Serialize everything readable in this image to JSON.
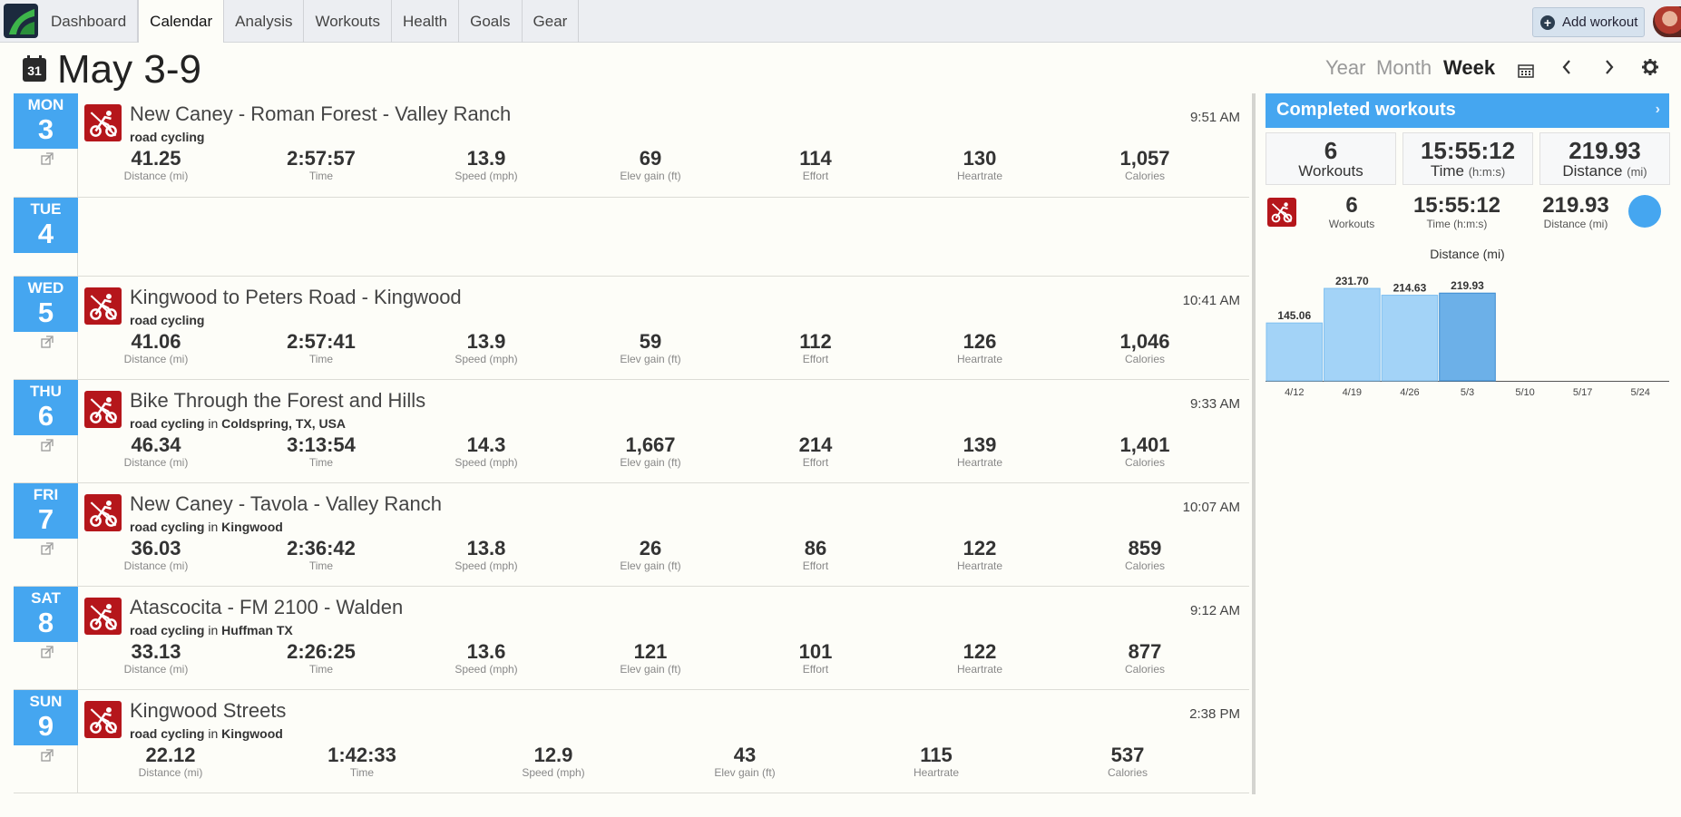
{
  "nav": {
    "tabs": [
      {
        "label": "Dashboard"
      },
      {
        "label": "Calendar"
      },
      {
        "label": "Analysis"
      },
      {
        "label": "Workouts"
      },
      {
        "label": "Health"
      },
      {
        "label": "Goals"
      },
      {
        "label": "Gear"
      }
    ],
    "active_tab": "Calendar",
    "add_workout": "Add workout"
  },
  "header": {
    "calendar_icon_day": "31",
    "title": "May 3-9",
    "views": {
      "year": "Year",
      "month": "Month",
      "week": "Week"
    },
    "active_view": "Week"
  },
  "days": [
    {
      "day": "MON",
      "date": "3",
      "workout": {
        "title": "New Caney - Roman Forest - Valley Ranch",
        "sport": "road cycling",
        "location": "",
        "time": "9:51 AM",
        "stats": [
          {
            "value": "41.25",
            "label": "Distance (mi)"
          },
          {
            "value": "2:57:57",
            "label": "Time"
          },
          {
            "value": "13.9",
            "label": "Speed (mph)"
          },
          {
            "value": "69",
            "label": "Elev gain (ft)"
          },
          {
            "value": "114",
            "label": "Effort"
          },
          {
            "value": "130",
            "label": "Heartrate"
          },
          {
            "value": "1,057",
            "label": "Calories"
          }
        ]
      }
    },
    {
      "day": "TUE",
      "date": "4",
      "workout": null
    },
    {
      "day": "WED",
      "date": "5",
      "workout": {
        "title": "Kingwood to Peters Road - Kingwood",
        "sport": "road cycling",
        "location": "",
        "time": "10:41 AM",
        "stats": [
          {
            "value": "41.06",
            "label": "Distance (mi)"
          },
          {
            "value": "2:57:41",
            "label": "Time"
          },
          {
            "value": "13.9",
            "label": "Speed (mph)"
          },
          {
            "value": "59",
            "label": "Elev gain (ft)"
          },
          {
            "value": "112",
            "label": "Effort"
          },
          {
            "value": "126",
            "label": "Heartrate"
          },
          {
            "value": "1,046",
            "label": "Calories"
          }
        ]
      }
    },
    {
      "day": "THU",
      "date": "6",
      "workout": {
        "title": "Bike Through the Forest and Hills",
        "sport": "road cycling",
        "location": "Coldspring, TX, USA",
        "time": "9:33 AM",
        "stats": [
          {
            "value": "46.34",
            "label": "Distance (mi)"
          },
          {
            "value": "3:13:54",
            "label": "Time"
          },
          {
            "value": "14.3",
            "label": "Speed (mph)"
          },
          {
            "value": "1,667",
            "label": "Elev gain (ft)"
          },
          {
            "value": "214",
            "label": "Effort"
          },
          {
            "value": "139",
            "label": "Heartrate"
          },
          {
            "value": "1,401",
            "label": "Calories"
          }
        ]
      }
    },
    {
      "day": "FRI",
      "date": "7",
      "workout": {
        "title": "New Caney - Tavola - Valley Ranch",
        "sport": "road cycling",
        "location": "Kingwood",
        "time": "10:07 AM",
        "stats": [
          {
            "value": "36.03",
            "label": "Distance (mi)"
          },
          {
            "value": "2:36:42",
            "label": "Time"
          },
          {
            "value": "13.8",
            "label": "Speed (mph)"
          },
          {
            "value": "26",
            "label": "Elev gain (ft)"
          },
          {
            "value": "86",
            "label": "Effort"
          },
          {
            "value": "122",
            "label": "Heartrate"
          },
          {
            "value": "859",
            "label": "Calories"
          }
        ]
      }
    },
    {
      "day": "SAT",
      "date": "8",
      "workout": {
        "title": "Atascocita - FM 2100 - Walden",
        "sport": "road cycling",
        "location": "Huffman TX",
        "time": "9:12 AM",
        "stats": [
          {
            "value": "33.13",
            "label": "Distance (mi)"
          },
          {
            "value": "2:26:25",
            "label": "Time"
          },
          {
            "value": "13.6",
            "label": "Speed (mph)"
          },
          {
            "value": "121",
            "label": "Elev gain (ft)"
          },
          {
            "value": "101",
            "label": "Effort"
          },
          {
            "value": "122",
            "label": "Heartrate"
          },
          {
            "value": "877",
            "label": "Calories"
          }
        ]
      }
    },
    {
      "day": "SUN",
      "date": "9",
      "workout": {
        "title": "Kingwood Streets",
        "sport": "road cycling",
        "location": "Kingwood",
        "time": "2:38 PM",
        "stats": [
          {
            "value": "22.12",
            "label": "Distance (mi)"
          },
          {
            "value": "1:42:33",
            "label": "Time"
          },
          {
            "value": "12.9",
            "label": "Speed (mph)"
          },
          {
            "value": "43",
            "label": "Elev gain (ft)"
          },
          {
            "value": "115",
            "label": "Heartrate"
          },
          {
            "value": "537",
            "label": "Calories"
          }
        ]
      }
    }
  ],
  "in_word": "in",
  "summary": {
    "title": "Completed workouts",
    "totals": [
      {
        "value": "6",
        "label": "Workouts",
        "unit": ""
      },
      {
        "value": "15:55:12",
        "label": "Time",
        "unit": "(h:m:s)"
      },
      {
        "value": "219.93",
        "label": "Distance",
        "unit": "(mi)"
      }
    ],
    "by_sport": [
      {
        "value": "6",
        "label": "Workouts"
      },
      {
        "value": "15:55:12",
        "label": "Time (h:m:s)"
      },
      {
        "value": "219.93",
        "label": "Distance (mi)"
      }
    ]
  },
  "colors": {
    "accent": "#45a6f0",
    "sport": "#b5161b",
    "bar": "#a3d3f7",
    "bar_current": "#6cb0e8"
  },
  "chart_data": {
    "type": "bar",
    "title": "Distance (mi)",
    "categories": [
      "4/12",
      "4/19",
      "4/26",
      "5/3",
      "5/10",
      "5/17",
      "5/24"
    ],
    "values": [
      145.06,
      231.7,
      214.63,
      219.93,
      null,
      null,
      null
    ],
    "value_labels": [
      "145.06",
      "231.70",
      "214.63",
      "219.93",
      "",
      "",
      ""
    ],
    "highlight": "5/3",
    "ylim": [
      0,
      250
    ]
  }
}
